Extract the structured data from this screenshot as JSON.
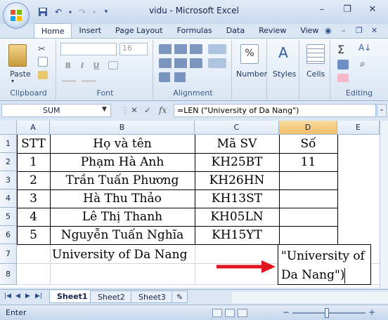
{
  "window": {
    "title": "vidu - Microsoft Excel",
    "controls": {
      "minimize": "–",
      "restore": "❐",
      "close": "✕"
    }
  },
  "quick_access": [
    "save-icon",
    "undo-icon",
    "redo-icon",
    "customize-icon"
  ],
  "ribbon": {
    "tabs": [
      "Home",
      "Insert",
      "Page Layout",
      "Formulas",
      "Data",
      "Review",
      "View"
    ],
    "active_tab": "Home",
    "groups": {
      "clipboard": {
        "label": "Clipboard",
        "paste": "Paste"
      },
      "font": {
        "label": "Font",
        "size": "16",
        "bold": "B",
        "italic": "I",
        "underline": "U"
      },
      "alignment": {
        "label": "Alignment"
      },
      "number": {
        "label": "Number",
        "symbol": "%"
      },
      "styles": {
        "label": "Styles"
      },
      "cells": {
        "label": "Cells"
      },
      "editing": {
        "label": "Editing",
        "sigma": "Σ"
      }
    }
  },
  "formula_bar": {
    "name_box": "SUM",
    "cancel": "✕",
    "enter": "✓",
    "fx": "fx",
    "formula": "=LEN (\"University of Da Nang\")"
  },
  "grid": {
    "columns": [
      "A",
      "B",
      "C",
      "D",
      "E"
    ],
    "selected_column": "D",
    "rows": [
      "1",
      "2",
      "3",
      "4",
      "5",
      "6",
      "7",
      "8"
    ],
    "header": {
      "stt": "STT",
      "name": "Họ và tên",
      "id": "Mã SV",
      "num": "Số"
    },
    "data": [
      {
        "stt": "1",
        "name": "Phạm Hà Anh",
        "id": "KH25BT",
        "num": "11"
      },
      {
        "stt": "2",
        "name": "Trần Tuấn Phương",
        "id": "KH26HN",
        "num": ""
      },
      {
        "stt": "3",
        "name": "Hà Thu Thảo",
        "id": "KH13ST",
        "num": ""
      },
      {
        "stt": "4",
        "name": "Lê Thị Thanh",
        "id": "KH05LN",
        "num": ""
      },
      {
        "stt": "5",
        "name": "Nguyễn Tuấn Nghĩa",
        "id": "KH15YT",
        "num": ""
      }
    ],
    "b7": "University of Da Nang",
    "d7_line1": "\"University of",
    "d8_line2": "Da Nang\")",
    "annotation_color": "#e0141e"
  },
  "sheets": [
    "Sheet1",
    "Sheet2",
    "Sheet3"
  ],
  "active_sheet": "Sheet1",
  "status": {
    "mode": "Enter",
    "zoom_minus": "−",
    "zoom_plus": "+"
  }
}
